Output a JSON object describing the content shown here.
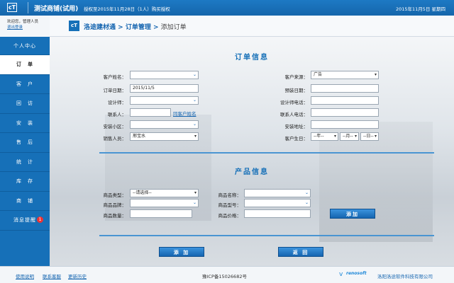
{
  "topbar": {
    "logo": "cT",
    "title": "测试商铺(试用)",
    "auth": "授权至2015年11月28日（1人）购买授权",
    "date": "2015年11月5日 星期四"
  },
  "sidebar": {
    "welcome": "欢迎您，管理人员",
    "logout": "退出登录",
    "items": [
      {
        "label": "个人中心"
      },
      {
        "label": "订　单"
      },
      {
        "label": "客　户"
      },
      {
        "label": "回　访"
      },
      {
        "label": "安　装"
      },
      {
        "label": "售　后"
      },
      {
        "label": "统　计"
      },
      {
        "label": "库　存"
      },
      {
        "label": "商　铺"
      },
      {
        "label": "消息提醒",
        "badge": "1"
      }
    ]
  },
  "breadcrumb": {
    "icon": "cT",
    "root": "洛途建材通",
    "sep1": " > ",
    "mid": "订单管理",
    "sep2": " > ",
    "current": "添加订单"
  },
  "order": {
    "title": "订单信息",
    "customer_name_label": "客户姓名：",
    "customer_name_value": "",
    "order_date_label": "订单日期：",
    "order_date_value": "2015/11/5",
    "designer_label": "设计师：",
    "designer_value": "",
    "contact_label": "联系人：",
    "contact_value": "",
    "same_name_link": "同客户姓名",
    "community_label": "安装小区：",
    "community_value": "",
    "sales_label": "销售人员：",
    "sales_value": "邢宝水",
    "source_label": "客户来源：",
    "source_value": "广告",
    "deposit_label": "预装日期：",
    "deposit_value": "",
    "designer_phone_label": "设计师电话：",
    "designer_phone_value": "",
    "contact_phone_label": "联系人电话：",
    "contact_phone_value": "",
    "address_label": "安装地址：",
    "address_value": "",
    "birthday_label": "客户生日：",
    "birthday_year": "--年--",
    "birthday_month": "--月--",
    "birthday_day": "--日--"
  },
  "product": {
    "title": "产品信息",
    "type_label": "商品类型：",
    "type_value": "--请选择--",
    "name_label": "商品名称：",
    "name_value": "",
    "brand_label": "商品品牌：",
    "brand_value": "",
    "model_label": "商品型号：",
    "model_value": "",
    "qty_label": "商品数量：",
    "qty_value": "",
    "price_label": "商品价格：",
    "price_value": "",
    "add_label": "添加"
  },
  "actions": {
    "add_label": "添 加",
    "back_label": "返 回"
  },
  "footer": {
    "help": "使用说明",
    "service": "联系客服",
    "history": "更新历史",
    "icp": "豫ICP备15026682号",
    "brand": "renosoft",
    "company": "洛阳洛途软件科技有限公司"
  }
}
